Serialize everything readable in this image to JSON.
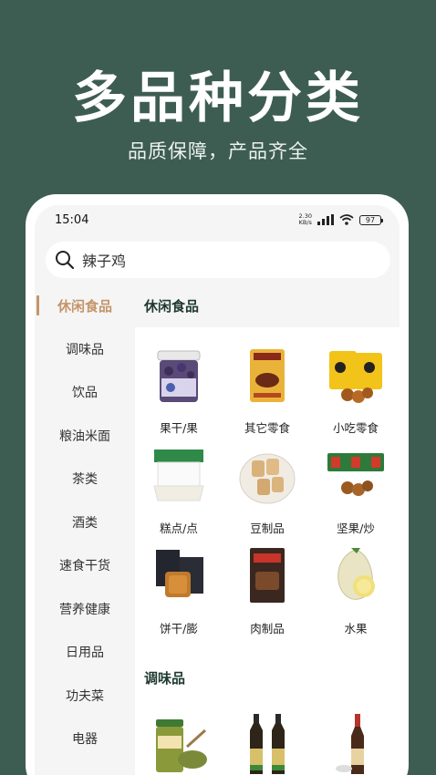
{
  "hero": {
    "title": "多品种分类",
    "subtitle": "品质保障，产品齐全"
  },
  "status": {
    "time": "15:04",
    "speed_value": "2.30",
    "speed_unit": "KB/s",
    "battery": "97"
  },
  "search": {
    "query": "辣子鸡"
  },
  "sidebar": {
    "items": [
      {
        "label": "休闲食品"
      },
      {
        "label": "调味品"
      },
      {
        "label": "饮品"
      },
      {
        "label": "粮油米面"
      },
      {
        "label": "茶类"
      },
      {
        "label": "酒类"
      },
      {
        "label": "速食干货"
      },
      {
        "label": "营养健康"
      },
      {
        "label": "日用品"
      },
      {
        "label": "功夫菜"
      },
      {
        "label": "电器"
      }
    ]
  },
  "sections": [
    {
      "title": "休闲食品",
      "items": [
        {
          "label": "果干/果",
          "icon": "dried-fruit-jar-icon"
        },
        {
          "label": "其它零食",
          "icon": "beef-jerky-pack-icon"
        },
        {
          "label": "小吃零食",
          "icon": "snack-bags-icon"
        },
        {
          "label": "糕点/点",
          "icon": "pastry-icon"
        },
        {
          "label": "豆制品",
          "icon": "tofu-plate-icon"
        },
        {
          "label": "坚果/炒",
          "icon": "nut-boxes-icon"
        },
        {
          "label": "饼干/膨",
          "icon": "biscuit-boxes-icon"
        },
        {
          "label": "肉制品",
          "icon": "meat-pack-icon"
        },
        {
          "label": "水果",
          "icon": "pomelo-icon"
        }
      ]
    },
    {
      "title": "调味品",
      "items": [
        {
          "label": "",
          "icon": "pepper-jar-icon"
        },
        {
          "label": "",
          "icon": "soy-sauce-bottles-icon"
        },
        {
          "label": "",
          "icon": "vinegar-bottle-icon"
        }
      ]
    }
  ],
  "colors": {
    "background": "#3d5d52",
    "accent": "#c4956a",
    "sidebar_bg": "#f5f5f5"
  }
}
